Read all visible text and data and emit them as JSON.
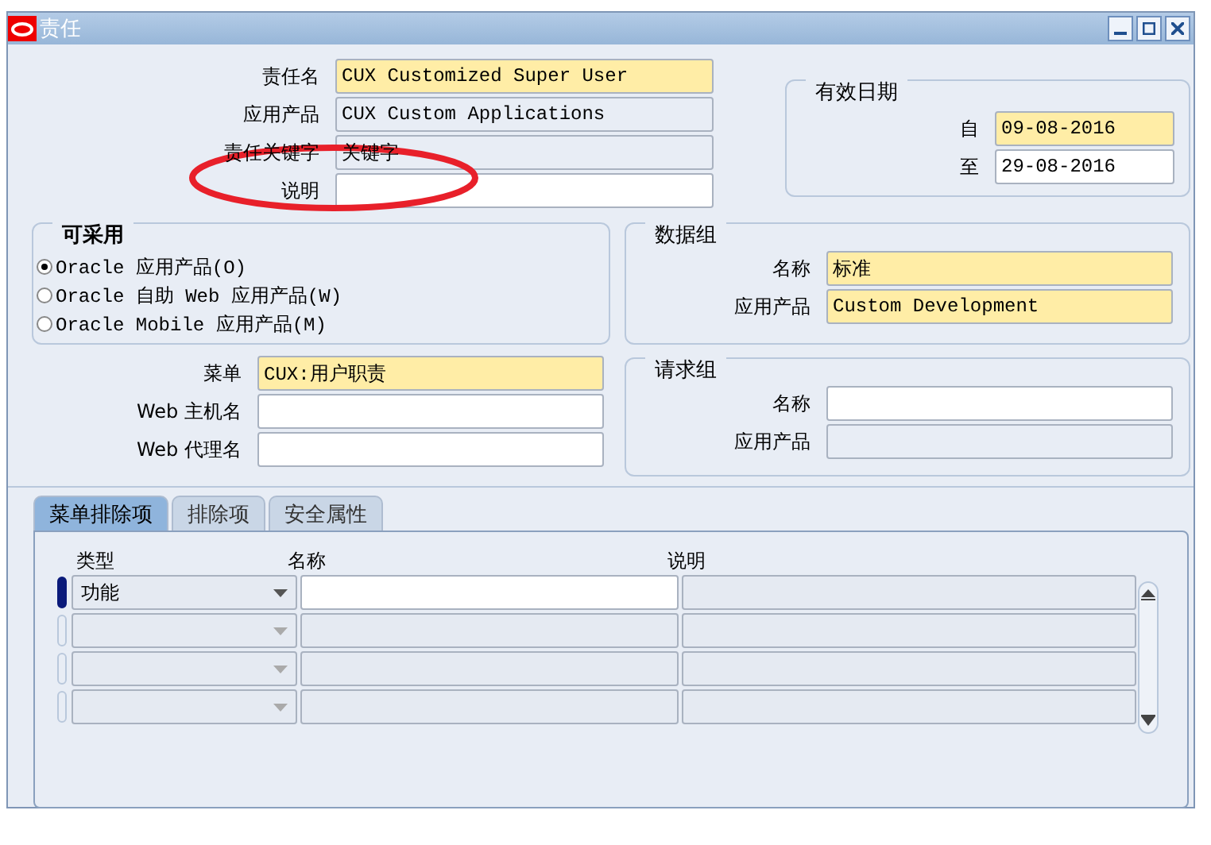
{
  "window": {
    "title": "责任"
  },
  "fields": [
    {
      "label": "责任名",
      "value": "CUX Customized Super User",
      "kind": "required"
    },
    {
      "label": "应用产品",
      "value": "CUX Custom Applications",
      "kind": "readonly"
    },
    {
      "label": "责任关键字",
      "value": "关键字",
      "kind": "readonly"
    },
    {
      "label": "说明",
      "kind": "editable"
    }
  ],
  "effective_dates": {
    "title": "有效日期",
    "fields": [
      {
        "label": "自",
        "value": "09-08-2016",
        "kind": "required"
      },
      {
        "label": "至",
        "value": "29-08-2016",
        "kind": "editable"
      }
    ]
  },
  "available": {
    "title": "可采用",
    "options": [
      {
        "label": "Oracle 应用产品(O)",
        "selected": true
      },
      {
        "label": "Oracle 自助 Web 应用产品(W)",
        "selected": false
      },
      {
        "label": "Oracle Mobile 应用产品(M)",
        "selected": false
      }
    ]
  },
  "data_group": {
    "title": "数据组",
    "fields": [
      {
        "label": "名称",
        "value": "标准",
        "kind": "required"
      },
      {
        "label": "应用产品",
        "value": "Custom Development",
        "kind": "required"
      }
    ]
  },
  "menu_fields": [
    {
      "label": "菜单",
      "value": "CUX:用户职责",
      "kind": "required"
    },
    {
      "label": "Web 主机名",
      "kind": "editable"
    },
    {
      "label": "Web 代理名",
      "kind": "editable"
    }
  ],
  "request_group": {
    "title": "请求组",
    "fields": [
      {
        "label": "名称",
        "kind": "editable"
      },
      {
        "label": "应用产品",
        "kind": "readonly"
      }
    ]
  },
  "tabs": [
    {
      "label": "菜单排除项",
      "selected": true
    },
    {
      "label": "排除项",
      "selected": false
    },
    {
      "label": "安全属性",
      "selected": false
    }
  ],
  "table": {
    "columns": [
      "类型",
      "名称",
      "说明"
    ],
    "rows": [
      {
        "selected": true,
        "type": "功能"
      },
      {
        "selected": false
      },
      {
        "selected": false
      },
      {
        "selected": false
      }
    ]
  }
}
